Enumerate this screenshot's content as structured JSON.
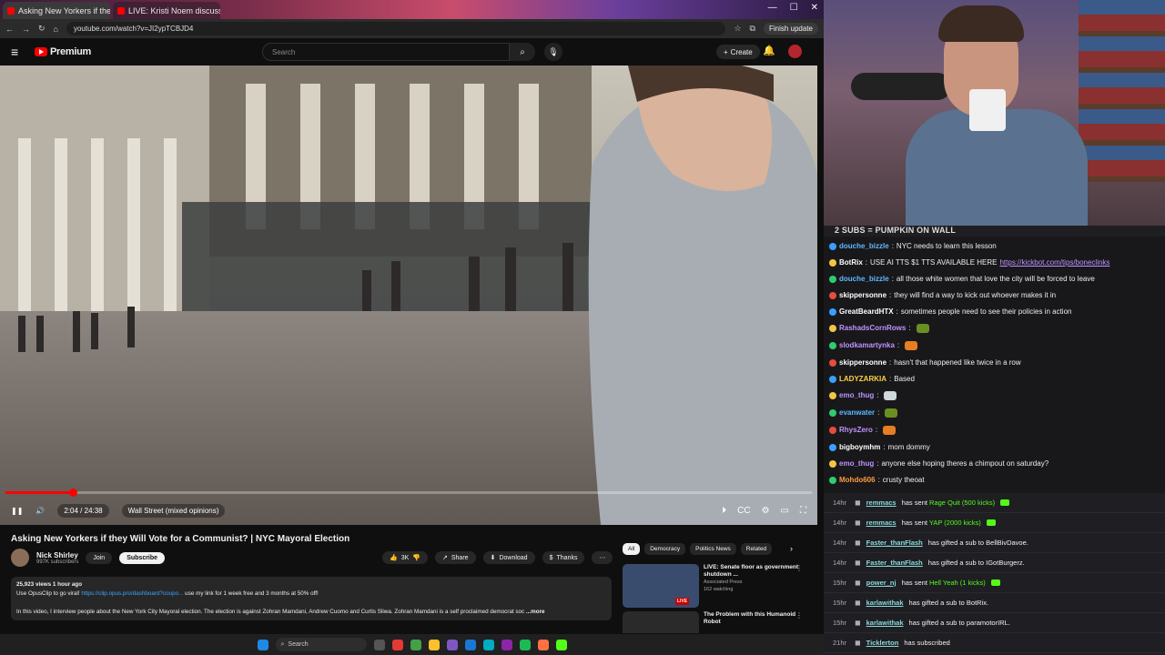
{
  "browser": {
    "tabs": [
      {
        "title": "Asking New Yorkers if they",
        "active": true
      },
      {
        "title": "LIVE: Kristi Noem discusses 'O",
        "active": false
      }
    ],
    "url": "youtube.com/watch?v=JI2ypTCBJD4",
    "update_label": "Finish update"
  },
  "youtube": {
    "brand": "Premium",
    "search_placeholder": "Search",
    "create_label": "Create"
  },
  "player": {
    "time": "2:04 / 24:38",
    "chapter": "Wall Street (mixed opinions)",
    "progress_fraction": 0.084
  },
  "video": {
    "title": "Asking New Yorkers if they Will Vote for a Communist? | NYC Mayoral Election",
    "channel": "Nick Shirley",
    "subscribers": "997K subscribers",
    "join_label": "Join",
    "subscribe_label": "Subscribe",
    "likes": "3K",
    "share_label": "Share",
    "download_label": "Download",
    "thanks_label": "Thanks",
    "stats": "25,923 views  1 hour ago",
    "desc_line1_a": "Use OpusClip to go viral! ",
    "desc_link": "https://clip.opus.pro/dashboard?coupo...",
    "desc_line1_b": " use my link for 1 week free and 3 months at 50% off!",
    "desc_line2": "In this video, I interview people about the New York City Mayoral election. The election is against Zohran Mamdani, Andrew Cuomo and Curtis Sliwa. Zohran Mamdani is a self proclaimed democrat soc",
    "more": "...more"
  },
  "related": {
    "chips": [
      "All",
      "Democracy",
      "Politics News",
      "Related"
    ],
    "items": [
      {
        "title": "LIVE: Senate floor as government shutdown ...",
        "channel": "Associated Press",
        "meta": "162 watching",
        "badge": "LIVE"
      },
      {
        "title": "The Problem with this Humanoid Robot",
        "channel": "",
        "meta": "",
        "badge": ""
      }
    ]
  },
  "chat": {
    "pinned": "2 SUBS = PUMPKIN ON WALL",
    "messages": [
      {
        "user": "douche_bizzle",
        "color": "#5fb8ff",
        "text": "NYC needs to learn this lesson"
      },
      {
        "user": "BotRix",
        "color": "#ffffff",
        "text": "USE AI TTS $1 TTS AVAILABLE HERE ",
        "link": "https://kickbot.com/tips/boneclinks"
      },
      {
        "user": "douche_bizzle",
        "color": "#5fb8ff",
        "text": "all those white women that love the city will be forced to leave"
      },
      {
        "user": "skippersonne",
        "color": "#ffffff",
        "text": "they will find a way to kick out whoever makes it in"
      },
      {
        "user": "GreatBeardHTX",
        "color": "#ffffff",
        "text": "sometimes people need to see their policies in action"
      },
      {
        "user": "RashadsCornRows",
        "color": "#bf94ff",
        "text": ""
      },
      {
        "user": "slodkamartynka",
        "color": "#bf94ff",
        "text": ""
      },
      {
        "user": "skippersonne",
        "color": "#ffffff",
        "text": "hasn't that happened like twice in a row"
      },
      {
        "user": "LADYZARKIA",
        "color": "#ffd23f",
        "text": "Based"
      },
      {
        "user": "emo_thug",
        "color": "#bf94ff",
        "text": ""
      },
      {
        "user": "evanwater",
        "color": "#5fb8ff",
        "text": ""
      },
      {
        "user": "RhysZero",
        "color": "#bf94ff",
        "text": ""
      },
      {
        "user": "bigboymhm",
        "color": "#ffffff",
        "text": "mom dommy"
      },
      {
        "user": "emo_thug",
        "color": "#bf94ff",
        "text": "anyone else hoping theres a chimpout on saturday?"
      },
      {
        "user": "Mohdo606",
        "color": "#ff9a3c",
        "text": "crusty theoat"
      }
    ],
    "events": [
      {
        "time": "14hr",
        "user": "remmacs",
        "pre": "has sent ",
        "hl": "Rage Quit (500 kicks)",
        "kick": true
      },
      {
        "time": "14hr",
        "user": "remmacs",
        "pre": "has sent ",
        "hl": "YAP (2000 kicks)",
        "kick": true
      },
      {
        "time": "14hr",
        "user": "Faster_thanFlash",
        "pre": "has gifted a sub to ",
        "hl": "BellBivDavoe.",
        "kick": false
      },
      {
        "time": "14hr",
        "user": "Faster_thanFlash",
        "pre": "has gifted a sub to ",
        "hl": "IGotBurgerz.",
        "kick": false
      },
      {
        "time": "15hr",
        "user": "power_nj",
        "pre": "has sent ",
        "hl": "Hell Yeah (1 kicks)",
        "kick": true
      },
      {
        "time": "15hr",
        "user": "karlawithak",
        "pre": "has gifted a sub to ",
        "hl": "BotRix.",
        "kick": false
      },
      {
        "time": "15hr",
        "user": "karlawithak",
        "pre": "has gifted a sub to ",
        "hl": "paramotorIRL.",
        "kick": false
      },
      {
        "time": "21hr",
        "user": "Ticklerton",
        "pre": "has subscribed",
        "hl": "",
        "kick": false
      }
    ]
  },
  "taskbar": {
    "search_placeholder": "Search"
  },
  "colors": {
    "yt_red": "#ff0000",
    "kick_green": "#53fc18",
    "chat_bg": "#18181b"
  }
}
